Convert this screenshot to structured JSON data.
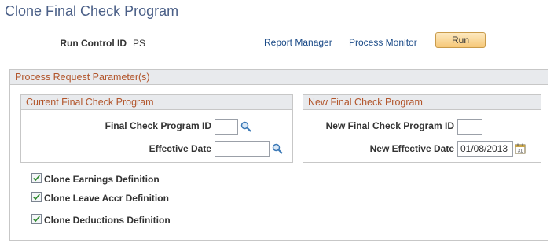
{
  "page": {
    "title": "Clone Final Check Program"
  },
  "run_control": {
    "label": "Run Control ID",
    "value": "PS"
  },
  "toolbar": {
    "report_manager": "Report Manager",
    "process_monitor": "Process Monitor",
    "run_label": "Run"
  },
  "process_params": {
    "header": "Process Request Parameter(s)"
  },
  "current": {
    "header": "Current Final Check Program",
    "program_id_label": "Final Check Program ID",
    "program_id_value": "",
    "effective_date_label": "Effective Date",
    "effective_date_value": ""
  },
  "new": {
    "header": "New Final Check Program",
    "program_id_label": "New Final Check Program ID",
    "program_id_value": "",
    "effective_date_label": "New Effective Date",
    "effective_date_value": "01/08/2013"
  },
  "options": {
    "clone_earnings": {
      "label": "Clone Earnings Definition",
      "checked": true
    },
    "clone_leave": {
      "label": "Clone Leave Accr Definition",
      "checked": true
    },
    "clone_deductions": {
      "label": "Clone Deductions Definition",
      "checked": true
    }
  },
  "colors": {
    "accent": "#b2552b",
    "title": "#4a5f87",
    "link": "#1a4a87",
    "button": "#f6c878"
  },
  "icons": {
    "lookup": "magnifier-icon",
    "calendar": "calendar-icon",
    "check": "checkmark-icon"
  }
}
